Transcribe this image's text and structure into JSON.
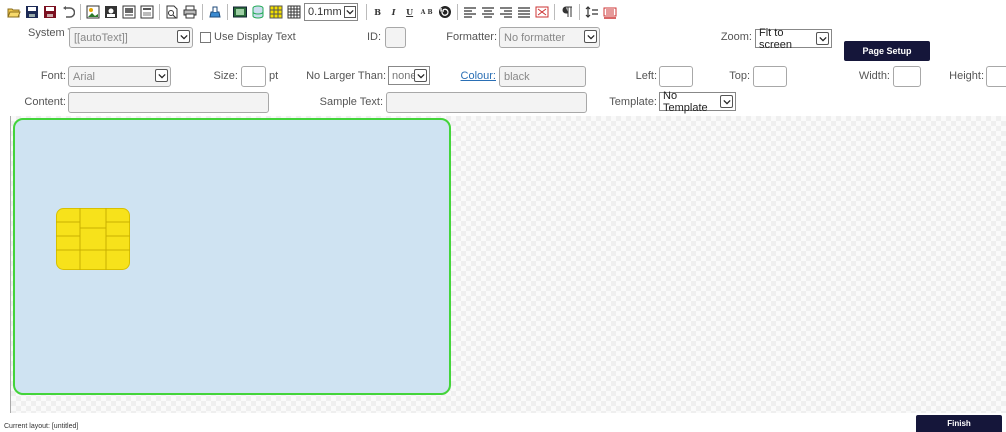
{
  "toolbar": {
    "unit_value": "0.1mm",
    "bold": "B",
    "italic": "I",
    "underline": "U",
    "smallcaps": "A B"
  },
  "form": {
    "system_text_label": "System Text:",
    "system_text_value": "[[autoText]]",
    "use_display_text_label": "Use Display Text",
    "id_label": "ID:",
    "id_value": "",
    "formatter_label": "Formatter:",
    "formatter_value": "No formatter",
    "zoom_label": "Zoom:",
    "zoom_value": "Fit to screen",
    "page_setup_label": "Page Setup",
    "font_label": "Font:",
    "font_value": "Arial",
    "size_label": "Size:",
    "size_value": "",
    "size_unit": "pt",
    "no_larger_than_label": "No Larger Than:",
    "no_larger_than_value": "none",
    "colour_label": "Colour:",
    "colour_value": "black",
    "left_label": "Left:",
    "top_label": "Top:",
    "width_label": "Width:",
    "height_label": "Height:",
    "content_label": "Content:",
    "content_value": "",
    "sample_text_label": "Sample Text:",
    "sample_text_value": "",
    "template_label": "Template:",
    "template_value": "No Template"
  },
  "canvas": {
    "card_color": "#cfe3f2",
    "card_border_color": "#43d43a",
    "chip_color": "#f7e21b"
  },
  "footer": {
    "status_text": "Current layout: [untitled]",
    "finish_label": "Finish"
  },
  "colors": {
    "button_dark": "#15163a",
    "link": "#2a6fb5"
  }
}
